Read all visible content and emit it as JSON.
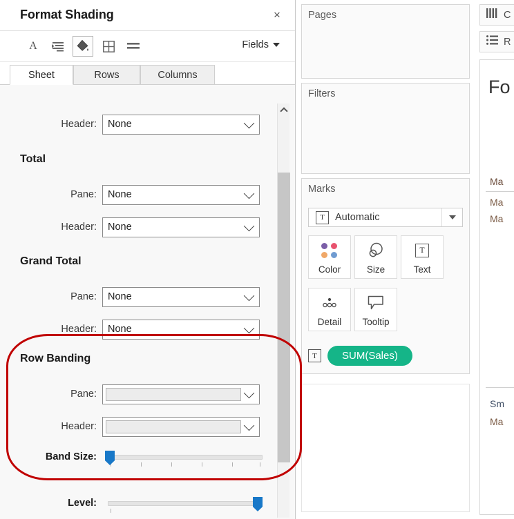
{
  "format_panel": {
    "title": "Format Shading",
    "close_label": "×",
    "toolbar": {
      "font_icon_label": "A",
      "align_icon": "align-icon",
      "shading_icon": "shading-icon",
      "borders_icon": "borders-icon",
      "lines_icon": "lines-icon",
      "fields_label": "Fields"
    },
    "tabs": [
      {
        "label": "Sheet",
        "active": true
      },
      {
        "label": "Rows",
        "active": false
      },
      {
        "label": "Columns",
        "active": false
      }
    ],
    "groups": [
      {
        "heading": "",
        "fields": [
          {
            "label": "Header:",
            "value": "None",
            "disabled": false
          }
        ]
      },
      {
        "heading": "Total",
        "fields": [
          {
            "label": "Pane:",
            "value": "None",
            "disabled": false
          },
          {
            "label": "Header:",
            "value": "None",
            "disabled": false
          }
        ]
      },
      {
        "heading": "Grand Total",
        "fields": [
          {
            "label": "Pane:",
            "value": "None",
            "disabled": false
          },
          {
            "label": "Header:",
            "value": "None",
            "disabled": false
          }
        ]
      },
      {
        "heading": "Row Banding",
        "fields": [
          {
            "label": "Pane:",
            "value": "",
            "disabled": true
          },
          {
            "label": "Header:",
            "value": "",
            "disabled": true
          }
        ]
      }
    ],
    "sliders": [
      {
        "label": "Band Size:",
        "position_pct": 0,
        "ticks": 6
      },
      {
        "label": "Level:",
        "position_pct": 100,
        "ticks": 1
      }
    ],
    "annotation": {
      "color": "#c00000",
      "shape": "rounded-rectangle",
      "targets": "Row Banding"
    }
  },
  "cards": [
    {
      "title": "Pages"
    },
    {
      "title": "Filters"
    },
    {
      "title": "Marks"
    }
  ],
  "marks": {
    "title": "Marks",
    "mark_type": "Automatic",
    "mark_type_glyph": "T",
    "buttons": [
      {
        "label": "Color",
        "icon": "color-dots-icon"
      },
      {
        "label": "Size",
        "icon": "size-circles-icon"
      },
      {
        "label": "Text",
        "icon": "text-t-icon"
      },
      {
        "label": "Detail",
        "icon": "detail-dots-icon"
      },
      {
        "label": "Tooltip",
        "icon": "tooltip-bubble-icon"
      }
    ],
    "color_dots": [
      "#7b5ea7",
      "#e8526e",
      "#f0a868",
      "#6f9bd1"
    ],
    "pill": {
      "glyph": "T",
      "label": "SUM(Sales)",
      "color": "#15b588"
    }
  },
  "view_panel": {
    "columns_shelf": {
      "icon": "columns-icon",
      "label": "C"
    },
    "rows_shelf": {
      "icon": "rows-icon",
      "label": "R"
    },
    "view_title": "Fo",
    "view_header": "Ma",
    "view_items": [
      "Ma",
      "Ma"
    ],
    "view_items_bottom": [
      "Sm",
      "Ma"
    ]
  }
}
